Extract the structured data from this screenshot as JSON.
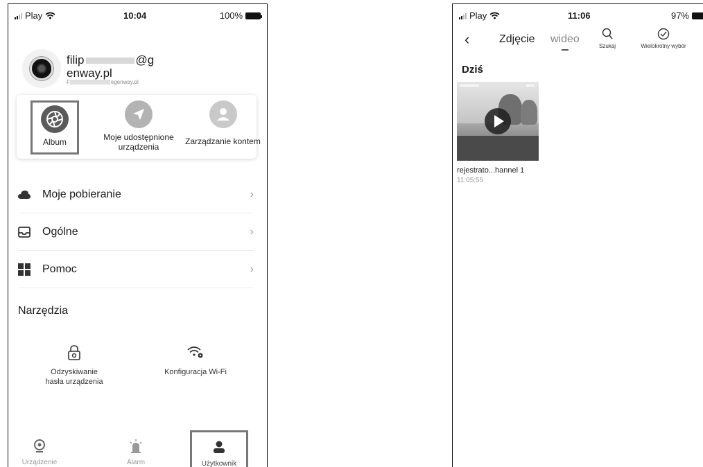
{
  "left": {
    "status": {
      "carrier": "Play",
      "time": "10:04",
      "battery": "100%"
    },
    "profile": {
      "name_part1": "filip",
      "name_part2": "@g",
      "name_part3": "enway.pl",
      "email_visible": "egenway.pl",
      "email_prefix": "F"
    },
    "quick_actions": [
      {
        "label": "Album",
        "icon": "camera-aperture-icon"
      },
      {
        "label": "Moje udostępnione urządzenia",
        "icon": "share-arrow-icon"
      },
      {
        "label": "Zarządzanie kontem",
        "icon": "person-icon"
      }
    ],
    "menu": [
      {
        "label": "Moje pobieranie",
        "icon": "cloud-icon"
      },
      {
        "label": "Ogólne",
        "icon": "inbox-icon"
      },
      {
        "label": "Pomoc",
        "icon": "grid-icon"
      }
    ],
    "tools_title": "Narzędzia",
    "tools": [
      {
        "label_line1": "Odzyskiwanie",
        "label_line2": "hasła urządzenia",
        "icon": "lock-icon"
      },
      {
        "label_line1": "Konfiguracja Wi-Fi",
        "label_line2": "",
        "icon": "wifi-gear-icon"
      }
    ],
    "tabbar": [
      {
        "label": "Urządzenie",
        "icon": "camera-icon"
      },
      {
        "label": "Alarm",
        "icon": "alarm-icon"
      },
      {
        "label": "Użytkownik",
        "icon": "user-icon"
      }
    ]
  },
  "right": {
    "status": {
      "carrier": "Play",
      "time": "11:06",
      "battery": "97%"
    },
    "tabs": {
      "photo": "Zdjęcie",
      "video": "wideo"
    },
    "actions": {
      "search": "Szukaj",
      "multi_select": "Wielokrotny wybór"
    },
    "section": "Dziś",
    "item": {
      "title": "rejestrato...hannel 1",
      "time": "11:05:55"
    }
  },
  "colors": {
    "highlight_border": "#777777",
    "text": "#1a1a1a",
    "muted": "#999999"
  }
}
